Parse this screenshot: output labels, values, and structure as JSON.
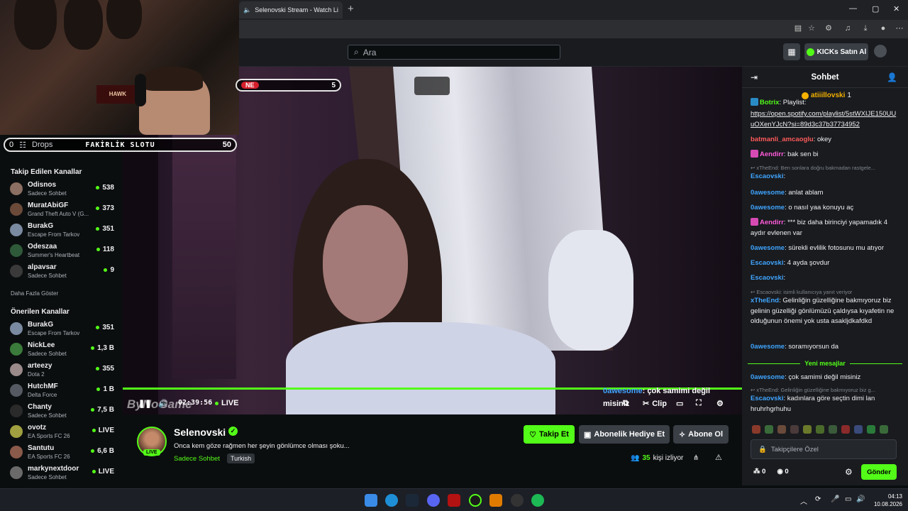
{
  "browser": {
    "tab_title": "Selenovski Stream - Watch Li",
    "tab_close": "✕",
    "new_tab": "+",
    "window_controls": [
      "—",
      "▢",
      "✕"
    ]
  },
  "header": {
    "search_placeholder": "Ara",
    "kicks_button": "KICKs Satın Al"
  },
  "overlay": {
    "slot_left_label": "Drops",
    "slot_title": "FAKİRLİK SLOTU",
    "slot_count": "50",
    "slot_zero": "0",
    "slot2_label": "NE",
    "slot2_count": "5",
    "cam_sign": "HAWK"
  },
  "sidebar": {
    "followed_heading": "Takip Edilen Kanallar",
    "followed": [
      {
        "name": "Odisnos",
        "category": "Sadece Sohbet",
        "viewers": "538",
        "color": "#8a6f62"
      },
      {
        "name": "MuratAbiGF",
        "category": "Grand Theft Auto V (G...",
        "viewers": "373",
        "color": "#6b4a3a"
      },
      {
        "name": "BurakG",
        "category": "Escape From Tarkov",
        "viewers": "351",
        "color": "#7a8aa0"
      },
      {
        "name": "Odeszaa",
        "category": "Summer's Heartbeat",
        "viewers": "118",
        "color": "#2f5a3a"
      },
      {
        "name": "alpavsar",
        "category": "Sadece Sohbet",
        "viewers": "9",
        "color": "#3a3a3a"
      }
    ],
    "more_label": "Daha Fazla Göster",
    "recommended_heading": "Önerilen Kanallar",
    "recommended": [
      {
        "name": "BurakG",
        "category": "Escape From Tarkov",
        "viewers": "351",
        "color": "#7a8aa0",
        "live": false
      },
      {
        "name": "NickLee",
        "category": "Sadece Sohbet",
        "viewers": "1,3 B",
        "color": "#3a7a3a",
        "live": false
      },
      {
        "name": "arteezy",
        "category": "Dota 2",
        "viewers": "355",
        "color": "#9a8a8a",
        "live": false
      },
      {
        "name": "HutchMF",
        "category": "Delta Force",
        "viewers": "1 B",
        "color": "#555a62",
        "live": false
      },
      {
        "name": "Chanty",
        "category": "Sadece Sohbet",
        "viewers": "7,5 B",
        "color": "#2a2a2a",
        "live": false
      },
      {
        "name": "ovotz",
        "category": "EA Sports FC 26",
        "viewers": "LIVE",
        "color": "#a0a040",
        "live": true
      },
      {
        "name": "Santutu",
        "category": "EA Sports FC 26",
        "viewers": "6,6 B",
        "color": "#8a5a4a",
        "live": false
      },
      {
        "name": "markynextdoor",
        "category": "Sadece Sohbet",
        "viewers": "LIVE",
        "color": "#6a6a6a",
        "live": true
      }
    ]
  },
  "player": {
    "logo_text": "ByNoGame",
    "time": "02:39:56",
    "live_label": "LIVE",
    "clip_label": "Clip",
    "overlay_chat_user": "0awesome",
    "overlay_chat_text": ": çok samimi değil",
    "overlay_chat_text2": "misiniz"
  },
  "stream": {
    "name": "Selenovski",
    "title": "Onca kem göze rağmen her şeyin gönlümce olması şoku...",
    "category": "Sadece Sohbet",
    "tag": "Turkish",
    "live_badge": "LIVE",
    "follow": "Takip Et",
    "gift_sub": "Abonelik Hediye Et",
    "subscribe": "Abone Ol",
    "viewer_count": "35",
    "viewer_label": "kişi izliyor"
  },
  "chat": {
    "title": "Sohbet",
    "pinned_user": "atiiillovski",
    "pinned_count": "1",
    "new_messages": "Yeni mesajlar",
    "input_placeholder": "Takipçilere Özel",
    "points_a": "0",
    "points_b": "0",
    "send": "Gönder",
    "messages": [
      {
        "user": "Botrix",
        "text": ": Playlist:",
        "color": "#53fc18"
      },
      {
        "link": "https://open.spotify.com/playlist/5stWXIJE150UUuOXenYJcN?si=89d3c37b37734952"
      },
      {
        "user": "batmanli_amcaoglu",
        "text": ": okey",
        "color": "#ff5a5a"
      },
      {
        "user": "Aendirr",
        "text": ": bak sen bi",
        "color": "#ff5ad9"
      },
      {
        "reply": "xTheEnd: Ben sonlara doğru bakmadan rastgele..."
      },
      {
        "user": "Escaovski",
        "text": ":",
        "color": "#3fa5ff"
      },
      {
        "user": "0awesome",
        "text": ": anlat ablam",
        "color": "#3fa5ff"
      },
      {
        "user": "0awesome",
        "text": ": o nasıl yaa konuyu aç",
        "color": "#3fa5ff"
      },
      {
        "user": "Aendirr",
        "text": ": *** biz daha birinciyi yapamadık 4 aydır evlenen var",
        "color": "#ff5ad9"
      },
      {
        "user": "0awesome",
        "text": ": sürekli evlilik fotosunu mu atıyor",
        "color": "#3fa5ff"
      },
      {
        "user": "Escaovski",
        "text": ": 4 ayda şovdur",
        "color": "#3fa5ff"
      },
      {
        "user": "Escaovski",
        "text": ":",
        "color": "#3fa5ff"
      },
      {
        "reply": "Escaovski: isimli kullanıcıya yanıt veriyor"
      },
      {
        "user": "xTheEnd",
        "text": ": Gelinliğin güzelliğine bakmıyoruz biz gelinin güzelliği gönlümüzü çaldıysa kıyafetin ne olduğunun önemi yok usta asakljdkafdkd",
        "color": "#3fa5ff"
      },
      {
        "user": "0awesome",
        "text": ": soramıyorsun da",
        "color": "#3fa5ff"
      },
      {
        "user": "0awesome",
        "text": ": çok samimi değil misiniz",
        "color": "#3fa5ff"
      },
      {
        "reply": "xTheEnd: Gelinliğin güzelliğine bakmıyoruz biz g..."
      },
      {
        "user": "Escaovski",
        "text": ": kadınlara göre seçtin dimi lan hruhrhgrhuhu",
        "color": "#3fa5ff"
      }
    ]
  },
  "taskbar": {
    "time": "04:13",
    "date": "10.08.2026"
  },
  "colors": {
    "accent": "#53fc18",
    "bg": "#0b0e0f",
    "panel": "#191b1f"
  }
}
